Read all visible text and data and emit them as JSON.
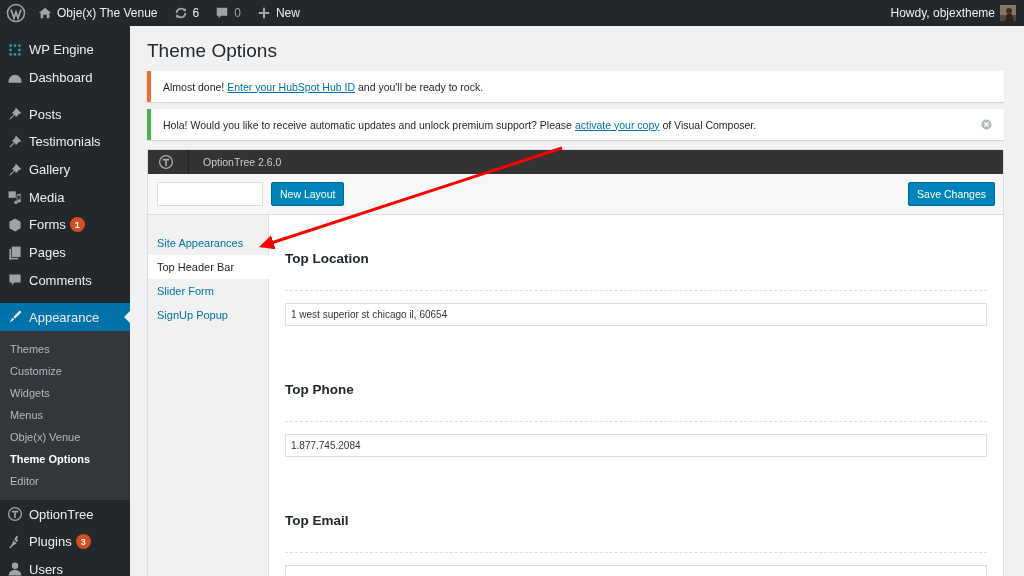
{
  "admin_bar": {
    "site": "Obje(x) The Venue",
    "updates": "6",
    "comments": "0",
    "new": "New",
    "greeting": "Howdy, objextheme"
  },
  "sidebar": {
    "items": [
      {
        "label": "WP Engine",
        "selected": false
      },
      {
        "label": "Dashboard",
        "selected": false
      },
      {
        "label": "Posts",
        "selected": false,
        "gap": true
      },
      {
        "label": "Testimonials",
        "selected": false
      },
      {
        "label": "Gallery",
        "selected": false
      },
      {
        "label": "Media",
        "selected": false
      },
      {
        "label": "Forms",
        "selected": false,
        "badge": "1"
      },
      {
        "label": "Pages",
        "selected": false
      },
      {
        "label": "Comments",
        "selected": false
      },
      {
        "label": "Appearance",
        "selected": true,
        "gap": true,
        "children": [
          {
            "label": "Themes",
            "selected": false
          },
          {
            "label": "Customize",
            "selected": false
          },
          {
            "label": "Widgets",
            "selected": false
          },
          {
            "label": "Menus",
            "selected": false
          },
          {
            "label": "Obje(x) Venue",
            "selected": false
          },
          {
            "label": "Theme Options",
            "selected": true
          },
          {
            "label": "Editor",
            "selected": false
          }
        ]
      },
      {
        "label": "OptionTree",
        "selected": false
      },
      {
        "label": "Plugins",
        "selected": false,
        "badge": "3"
      },
      {
        "label": "Users",
        "selected": false
      }
    ]
  },
  "page_title": "Theme Options",
  "notices": [
    {
      "color": "#f56e28",
      "before": "Almost done! ",
      "link": "Enter your HubSpot Hub ID",
      "after": " and you'll be ready to rock.",
      "dismissible": false
    },
    {
      "color": "#46b450",
      "before": "Hola! Would you like to receive automatic updates and unlock premium support? Please ",
      "link": "activate your copy",
      "after": " of Visual Composer.",
      "dismissible": true
    }
  ],
  "panel": {
    "title": "OptionTree 2.6.0",
    "new_layout": "New Layout",
    "save": "Save Changes",
    "tabs": [
      {
        "label": "Site Appearances",
        "selected": false
      },
      {
        "label": "Top Header Bar",
        "selected": true
      },
      {
        "label": "Slider Form",
        "selected": false
      },
      {
        "label": "SignUp Popup",
        "selected": false
      }
    ],
    "fields": [
      {
        "label": "Top Location",
        "value": "1 west superior st chicago il, 60654"
      },
      {
        "label": "Top Phone",
        "value": "1.877.745.2084"
      },
      {
        "label": "Top Email"
      }
    ]
  }
}
